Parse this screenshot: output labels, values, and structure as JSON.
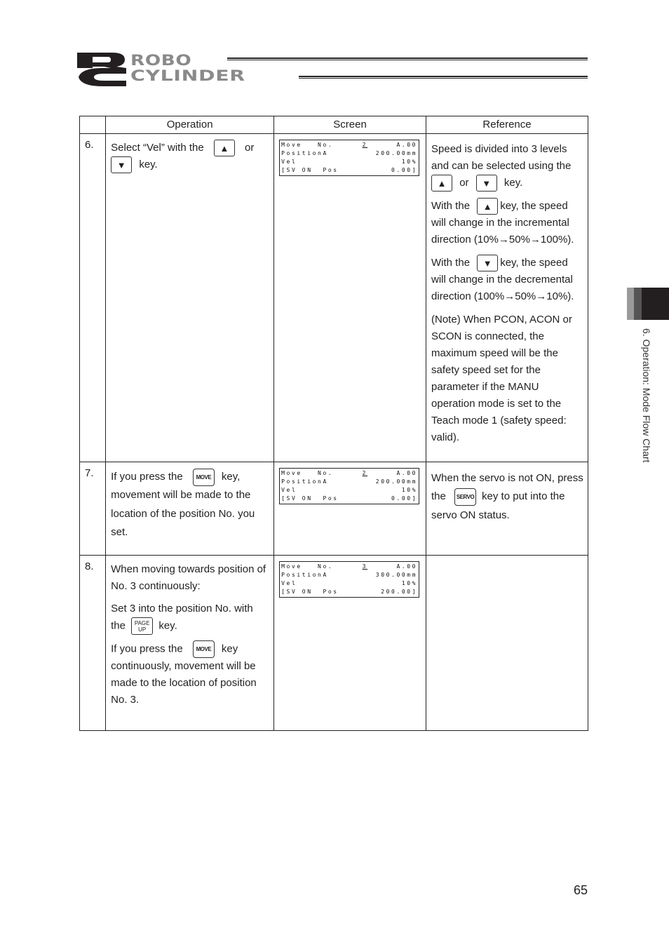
{
  "header": {
    "logo_mark": "RC",
    "logo_line1": "ROBO",
    "logo_line2": "CYLINDER"
  },
  "table": {
    "headers": [
      "",
      "Operation",
      "Screen",
      "Reference"
    ],
    "rows": [
      {
        "num": "6.",
        "operation": {
          "t1": "Select “Vel” with the",
          "t2": "or",
          "t3": "key."
        },
        "screen": {
          "lines": [
            {
              "left": "Move   No.",
              "mid": "2",
              "right": "A.00"
            },
            {
              "left": "PositionA",
              "mid": "",
              "right": "200.00mm"
            },
            {
              "left": "Vel",
              "mid": "",
              "right": "10%"
            },
            {
              "left": "[SV ON  Pos",
              "mid": "",
              "right": "0.00]"
            }
          ]
        },
        "reference": {
          "p1a": "Speed is divided into 3 levels and can be selected using the",
          "p1b": "or",
          "p1c": "key.",
          "p2a": "With the",
          "p2b": "key, the speed will change in the incremental direction (10%→50%→100%).",
          "p3a": "With the",
          "p3b": "key, the speed will change in the decremental direction (100%→50%→10%).",
          "p4": "(Note) When PCON, ACON or SCON is connected, the maximum speed will be the safety speed set for the parameter if the MANU operation mode is set to the Teach mode 1 (safety speed: valid)."
        }
      },
      {
        "num": "7.",
        "operation": {
          "t1": "If you press the",
          "t2": "key, movement will be made to the location of the position No. you set."
        },
        "screen": {
          "lines": [
            {
              "left": "Move   No.",
              "mid": "2",
              "right": "A.00"
            },
            {
              "left": "PositionA",
              "mid": "",
              "right": "200.00mm"
            },
            {
              "left": "Vel",
              "mid": "",
              "right": "10%"
            },
            {
              "left": "[SV ON  Pos",
              "mid": "",
              "right": "0.00]"
            }
          ]
        },
        "reference": {
          "t1": "When the servo is not ON, press the",
          "t2": "key to put into the servo ON status."
        }
      },
      {
        "num": "8.",
        "operation": {
          "p1": "When moving towards position of No. 3 continuously:",
          "p2a": "Set 3 into the position No. with the",
          "p2b": "key.",
          "p3a": "If you press the",
          "p3b": "key continuously, movement will be made to the location of position No. 3."
        },
        "screen": {
          "lines": [
            {
              "left": "Move   No.",
              "mid": "3",
              "right": "A.00"
            },
            {
              "left": "PositionA",
              "mid": "",
              "right": "300.00mm"
            },
            {
              "left": "Vel",
              "mid": "",
              "right": "10%"
            },
            {
              "left": "[SV ON  Pos",
              "mid": "",
              "right": "200.00]"
            }
          ]
        },
        "reference": {}
      }
    ]
  },
  "keys": {
    "up": "▲",
    "down": "▼",
    "move": "MOVE",
    "servo": "SERVO",
    "page_up_line1": "PAGE",
    "page_up_line2": "UP"
  },
  "side_tab": {
    "label": "6. Operation: Mode Flow Chart"
  },
  "page_number": "65"
}
